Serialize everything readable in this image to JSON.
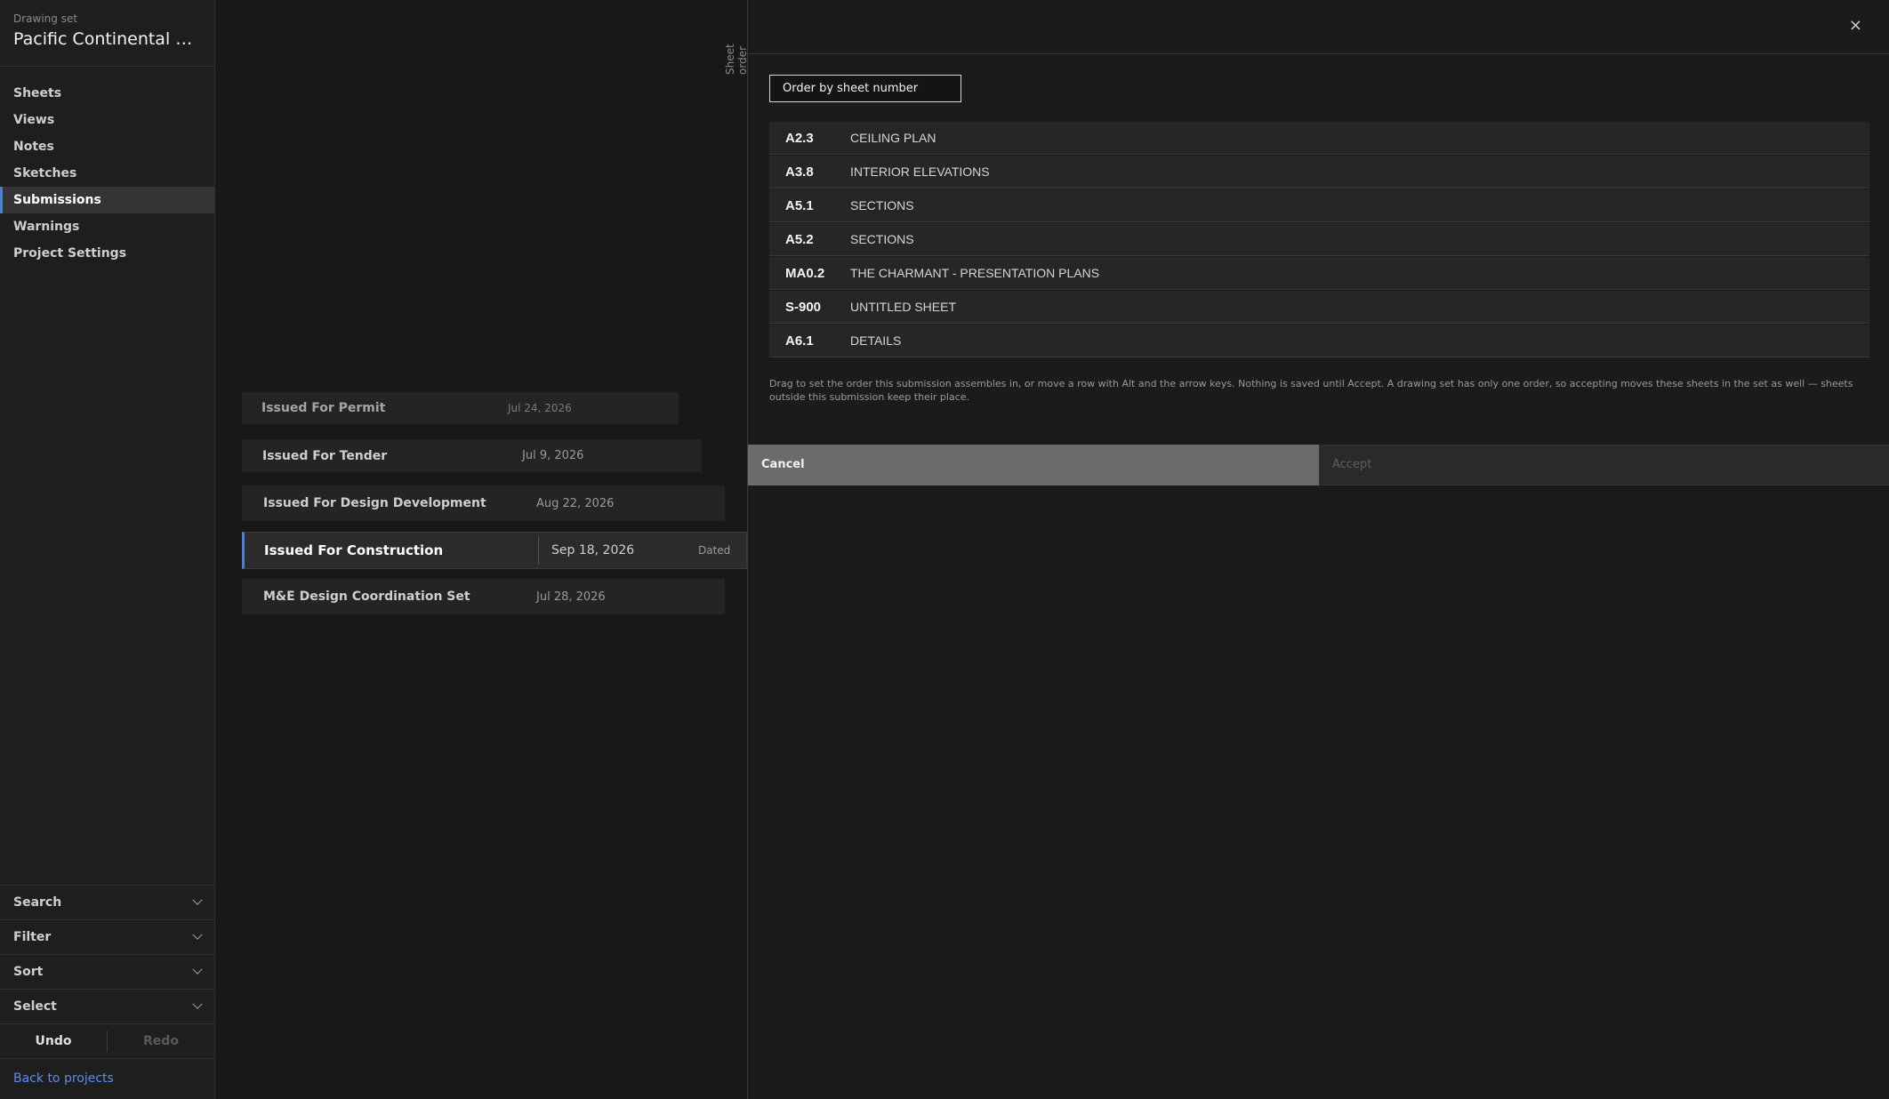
{
  "sidebar": {
    "caption": "Drawing set",
    "title": "Pacific Continental Res...",
    "nav": [
      {
        "label": "Sheets"
      },
      {
        "label": "Views"
      },
      {
        "label": "Notes"
      },
      {
        "label": "Sketches"
      },
      {
        "label": "Submissions",
        "active": true
      },
      {
        "label": "Warnings"
      },
      {
        "label": "Project Settings"
      }
    ],
    "accordions": {
      "search": "Search",
      "filter": "Filter",
      "sort": "Sort",
      "select": "Select"
    },
    "undo": "Undo",
    "redo": "Redo",
    "back": "Back to projects"
  },
  "sheet_order_tab": "Sheet order",
  "submissions": [
    {
      "name": "Issued For Permit",
      "date": "Jul 24, 2026"
    },
    {
      "name": "Issued For Tender",
      "date": "Jul 9, 2026"
    },
    {
      "name": "Issued For Design Development",
      "date": "Aug 22, 2026"
    },
    {
      "name": "Issued For Construction",
      "date": "Sep 18, 2026",
      "badge": "Dated"
    },
    {
      "name": "M&E Design Coordination Set",
      "date": "Jul 28, 2026"
    }
  ],
  "panel": {
    "close": "×",
    "order_button": "Order by sheet number",
    "sheets": [
      {
        "number": "A2.3",
        "title": "CEILING PLAN"
      },
      {
        "number": "A3.8",
        "title": "INTERIOR ELEVATIONS"
      },
      {
        "number": "A5.1",
        "title": "SECTIONS"
      },
      {
        "number": "A5.2",
        "title": "SECTIONS"
      },
      {
        "number": "MA0.2",
        "title": "THE CHARMANT - PRESENTATION PLANS"
      },
      {
        "number": "S-900",
        "title": "UNTITLED SHEET"
      },
      {
        "number": "A6.1",
        "title": "DETAILS"
      }
    ],
    "help": "Drag to set the order this submission assembles in, or move a row with Alt and the arrow keys. Nothing is saved until Accept. A drawing set has only one order, so accepting moves these sheets in the set as well — sheets outside this submission keep their place.",
    "cancel": "Cancel",
    "accept": "Accept"
  }
}
